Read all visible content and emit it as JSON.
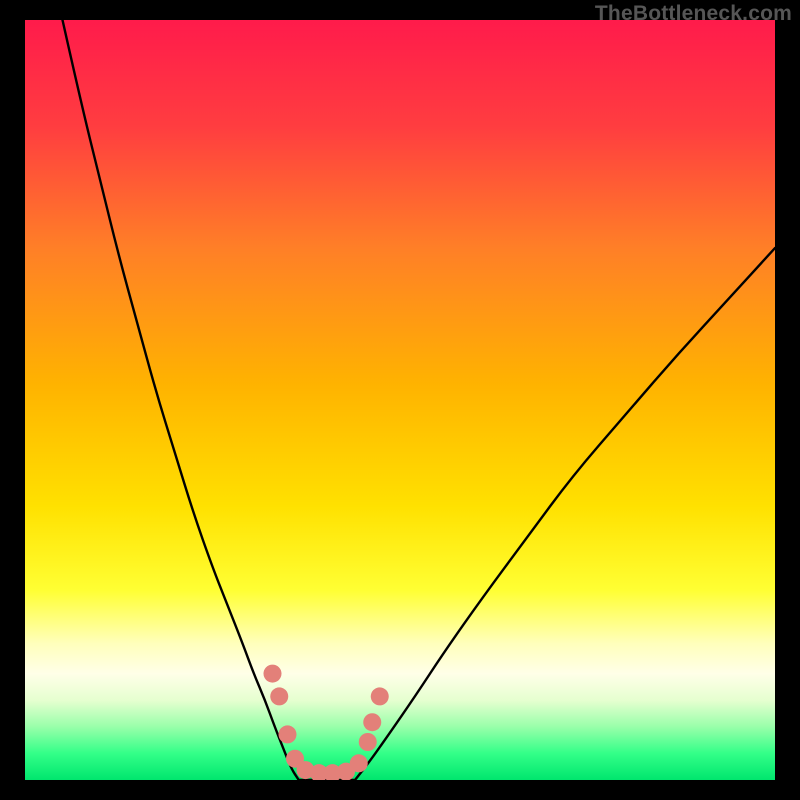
{
  "watermark": "TheBottleneck.com",
  "chart_data": {
    "type": "line",
    "title": "",
    "xlabel": "",
    "ylabel": "",
    "xlim": [
      0,
      100
    ],
    "ylim": [
      0,
      100
    ],
    "grid": false,
    "legend": false,
    "gradient_stops": [
      {
        "offset": 0.0,
        "color": "#ff1b4b"
      },
      {
        "offset": 0.14,
        "color": "#ff3d40"
      },
      {
        "offset": 0.3,
        "color": "#ff7f27"
      },
      {
        "offset": 0.48,
        "color": "#ffb300"
      },
      {
        "offset": 0.64,
        "color": "#ffe100"
      },
      {
        "offset": 0.75,
        "color": "#ffff33"
      },
      {
        "offset": 0.82,
        "color": "#ffffbb"
      },
      {
        "offset": 0.86,
        "color": "#ffffe8"
      },
      {
        "offset": 0.895,
        "color": "#e6ffd0"
      },
      {
        "offset": 0.93,
        "color": "#99ffaa"
      },
      {
        "offset": 0.965,
        "color": "#33ff88"
      },
      {
        "offset": 1.0,
        "color": "#00e66e"
      }
    ],
    "series": [
      {
        "name": "left-curve",
        "x": [
          5,
          7.5,
          10,
          12.5,
          15,
          17.5,
          20,
          22.5,
          25,
          27,
          29,
          30.5,
          32,
          33.3,
          34.5,
          35.5,
          36.5
        ],
        "y": [
          100,
          89,
          79,
          69,
          60,
          51,
          43,
          35,
          28,
          23,
          18,
          14,
          10.5,
          7,
          4,
          1.5,
          0
        ]
      },
      {
        "name": "bottom-flat",
        "x": [
          36.5,
          39,
          41.5,
          44
        ],
        "y": [
          0,
          0,
          0,
          0
        ]
      },
      {
        "name": "right-curve",
        "x": [
          44,
          46,
          48.5,
          52,
          56,
          61,
          67,
          73,
          80,
          87,
          94,
          100
        ],
        "y": [
          0,
          2.5,
          6,
          11,
          17,
          24,
          32,
          40,
          48,
          56,
          63.5,
          70
        ]
      }
    ],
    "markers": {
      "name": "dotted-segment",
      "color": "#e38079",
      "radius_px": 9,
      "points": [
        {
          "x": 33.0,
          "y": 14.0
        },
        {
          "x": 33.9,
          "y": 11.0
        },
        {
          "x": 35.0,
          "y": 6.0
        },
        {
          "x": 36.0,
          "y": 2.8
        },
        {
          "x": 37.4,
          "y": 1.3
        },
        {
          "x": 39.2,
          "y": 0.9
        },
        {
          "x": 41.0,
          "y": 0.9
        },
        {
          "x": 42.8,
          "y": 1.1
        },
        {
          "x": 44.5,
          "y": 2.2
        },
        {
          "x": 45.7,
          "y": 5.0
        },
        {
          "x": 46.3,
          "y": 7.6
        },
        {
          "x": 47.3,
          "y": 11.0
        }
      ]
    }
  }
}
